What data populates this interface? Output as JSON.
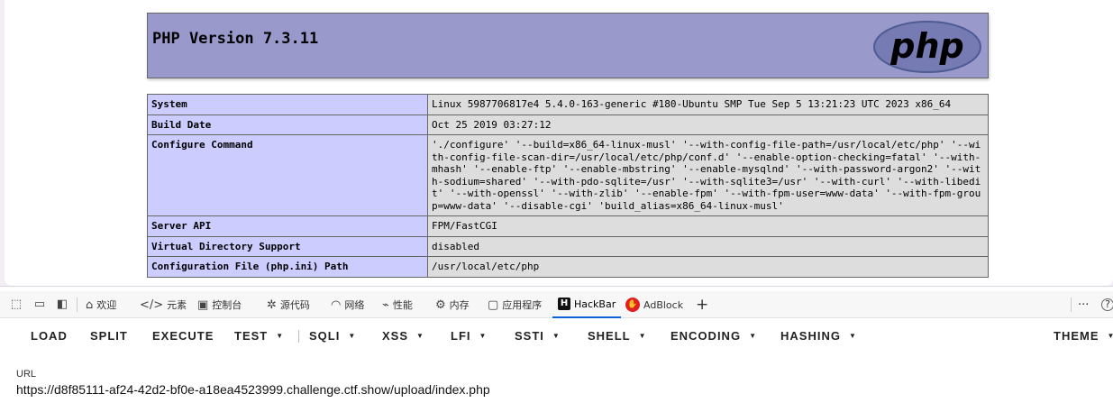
{
  "php_header": {
    "title": "PHP Version 7.3.11",
    "logo_text": "php"
  },
  "info_rows": [
    {
      "key": "System",
      "value": "Linux 5987706817e4 5.4.0-163-generic #180-Ubuntu SMP Tue Sep 5 13:21:23 UTC 2023 x86_64"
    },
    {
      "key": "Build Date",
      "value": "Oct 25 2019 03:27:12"
    },
    {
      "key": "Configure Command",
      "value": "'./configure' '--build=x86_64-linux-musl' '--with-config-file-path=/usr/local/etc/php' '--with-config-file-scan-dir=/usr/local/etc/php/conf.d' '--enable-option-checking=fatal' '--with-mhash' '--enable-ftp' '--enable-mbstring' '--enable-mysqlnd' '--with-password-argon2' '--with-sodium=shared' '--with-pdo-sqlite=/usr' '--with-sqlite3=/usr' '--with-curl' '--with-libedit' '--with-openssl' '--with-zlib' '--enable-fpm' '--with-fpm-user=www-data' '--with-fpm-group=www-data' '--disable-cgi' 'build_alias=x86_64-linux-musl'"
    },
    {
      "key": "Server API",
      "value": "FPM/FastCGI"
    },
    {
      "key": "Virtual Directory Support",
      "value": "disabled"
    },
    {
      "key": "Configuration File (php.ini) Path",
      "value": "/usr/local/etc/php"
    }
  ],
  "devtools": {
    "tabs": [
      {
        "label": "欢迎",
        "icon": "home-icon"
      },
      {
        "label": "元素",
        "icon": "code-icon"
      },
      {
        "label": "控制台",
        "icon": "console-icon"
      },
      {
        "label": "源代码",
        "icon": "bug-icon"
      },
      {
        "label": "网络",
        "icon": "wifi-icon"
      },
      {
        "label": "性能",
        "icon": "performance-icon"
      },
      {
        "label": "内存",
        "icon": "memory-icon"
      },
      {
        "label": "应用程序",
        "icon": "application-icon"
      },
      {
        "label": "HackBar",
        "icon": "hackbar-icon",
        "active": true
      },
      {
        "label": "AdBlock",
        "icon": "adblock-icon"
      }
    ],
    "add_tab": "+",
    "more": "···",
    "help": "?"
  },
  "hackbar": {
    "buttons": {
      "load": "LOAD",
      "split": "SPLIT",
      "execute": "EXECUTE",
      "test": "TEST",
      "sqli": "SQLI",
      "xss": "XSS",
      "lfi": "LFI",
      "ssti": "SSTI",
      "shell": "SHELL",
      "encoding": "ENCODING",
      "hashing": "HASHING",
      "theme": "THEME"
    },
    "url_label": "URL",
    "url_value": "https://d8f85111-af24-42d2-bf0e-a18ea4523999.challenge.ctf.show/upload/index.php"
  },
  "colors": {
    "php_header": "#9999cc",
    "key_cell": "#ccccff",
    "value_cell": "#dddddd",
    "active_tab": "#0b61d6",
    "adblock": "#e21e1e"
  }
}
